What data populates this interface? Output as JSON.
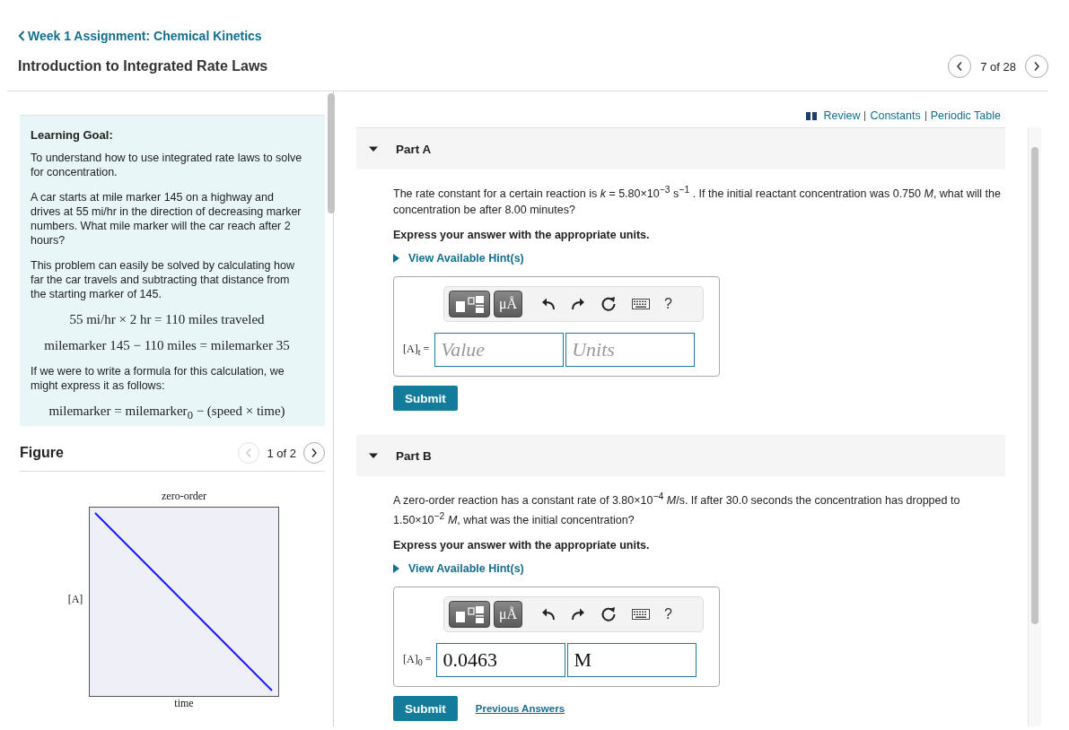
{
  "header": {
    "back_link": "Week 1 Assignment: Chemical Kinetics",
    "title": "Introduction to Integrated Rate Laws",
    "pager": {
      "label": "7 of 28",
      "prev_disabled": false
    }
  },
  "learning_goal": {
    "heading": "Learning Goal:",
    "blocks": [
      {
        "kind": "text",
        "text": "To understand how to use integrated rate laws to solve for concentration."
      },
      {
        "kind": "text",
        "text": "A car starts at mile marker 145 on a highway and drives at 55 mi/hr in the direction of decreasing marker numbers. What mile marker will the car reach after 2 hours?"
      },
      {
        "kind": "text",
        "text": "This problem can easily be solved by calculating how far the car travels and subtracting that distance from the starting marker of 145."
      },
      {
        "kind": "math",
        "text": "55 mi/hr × 2 hr = 110 miles traveled"
      },
      {
        "kind": "math",
        "text": "milemarker 145 − 110 miles = milemarker 35"
      },
      {
        "kind": "text",
        "text": "If we were to write a formula for this calculation, we might express it as follows:"
      },
      {
        "kind": "math",
        "text": "milemarker = milemarker$_{0}$ − (speed × time)"
      }
    ]
  },
  "figure": {
    "title": "Figure",
    "pager": {
      "label": "1 of 2",
      "prev_disabled": true
    },
    "graph": {
      "title": "zero-order",
      "ylabel": "[A]",
      "xlabel": "time"
    }
  },
  "links": [
    "Review",
    "Constants",
    "Periodic Table"
  ],
  "parts": [
    {
      "title": "Part A",
      "expanded": true,
      "question": "The rate constant for a certain reaction is *k* = 5.80×10$^{−3}$ s$^{−1}$ . If the initial reactant concentration was 0.750 *M*, what will the concentration be after 8.00 minutes?",
      "instruction": "Express your answer with the appropriate units.",
      "hint_link": "View Available Hint(s)",
      "toolbar": {
        "units_button": "μÅ",
        "help": "?"
      },
      "label": "[A]$_{t}$ =",
      "value_field": {
        "placeholder": "Value"
      },
      "units_field": {
        "placeholder": "Units"
      },
      "submit": "Submit"
    },
    {
      "title": "Part B",
      "expanded": true,
      "question": "A zero-order reaction has a constant rate of 3.80×10$^{−4}$ *M*/s. If after 30.0 seconds the concentration has dropped to 1.50×10$^{−2}$ *M*, what was the initial concentration?",
      "instruction": "Express your answer with the appropriate units.",
      "hint_link": "View Available Hint(s)",
      "toolbar": {
        "units_button": "μÅ",
        "help": "?"
      },
      "label": "[A]$_{0}$ =",
      "value_field": {
        "value": "0.0463"
      },
      "units_field": {
        "value": "M"
      },
      "submit": "Submit",
      "previous_answers": "Previous Answers"
    }
  ]
}
